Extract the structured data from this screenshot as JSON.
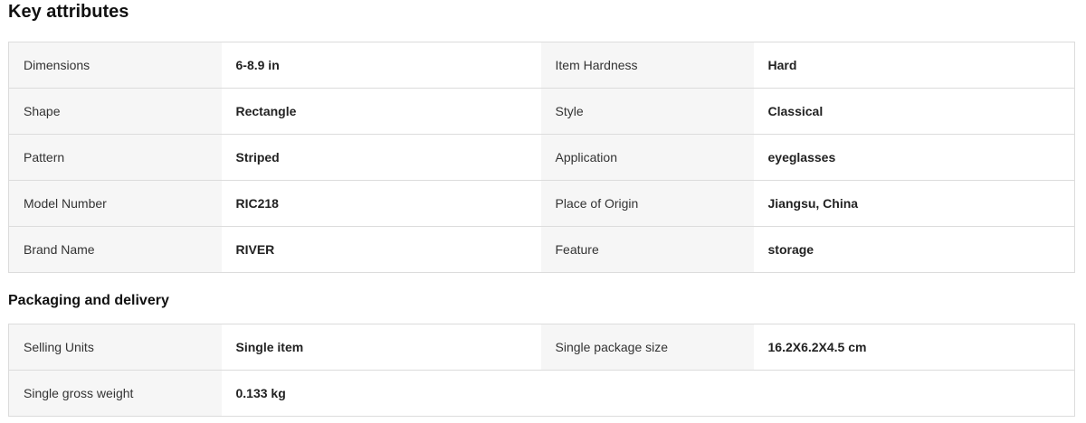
{
  "key_attributes": {
    "title": "Key attributes",
    "rows": [
      {
        "label1": "Dimensions",
        "value1": "6-8.9 in",
        "label2": "Item Hardness",
        "value2": "Hard"
      },
      {
        "label1": "Shape",
        "value1": "Rectangle",
        "label2": "Style",
        "value2": "Classical"
      },
      {
        "label1": "Pattern",
        "value1": "Striped",
        "label2": "Application",
        "value2": "eyeglasses"
      },
      {
        "label1": "Model Number",
        "value1": "RIC218",
        "label2": "Place of Origin",
        "value2": "Jiangsu, China"
      },
      {
        "label1": "Brand Name",
        "value1": "RIVER",
        "label2": "Feature",
        "value2": "storage"
      }
    ]
  },
  "packaging": {
    "title": "Packaging and delivery",
    "rows": [
      {
        "label1": "Selling Units",
        "value1": "Single item",
        "label2": "Single package size",
        "value2": "16.2X6.2X4.5 cm"
      },
      {
        "label1": "Single gross weight",
        "value1": "0.133 kg",
        "label2": "",
        "value2": ""
      }
    ]
  }
}
